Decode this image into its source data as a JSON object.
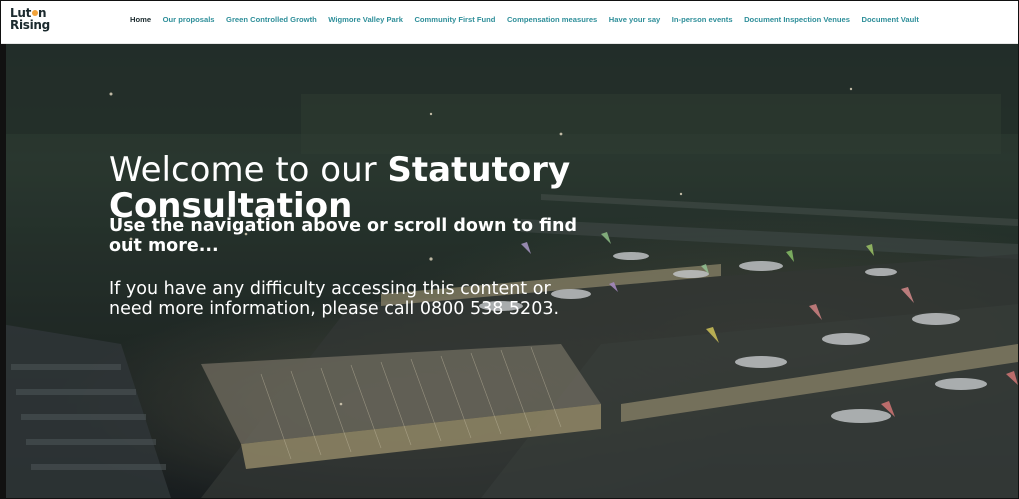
{
  "brand": {
    "line1": "Lut",
    "line1_after_dot": "n",
    "line2": "Rising"
  },
  "nav": {
    "items": [
      "Home",
      "Our proposals",
      "Green Controlled Growth",
      "Wigmore Valley Park",
      "Community First Fund",
      "Compensation measures",
      "Have your say",
      "In-person events",
      "Document Inspection Venues",
      "Document Vault"
    ],
    "active_index": 0
  },
  "hero": {
    "heading_prefix": "Welcome to our ",
    "heading_bold": "Statutory Consultation",
    "subheading": "Use the navigation above or scroll down to find out more...",
    "info": "If you have any difficulty accessing this content or need more information, please call 0800 538 5203."
  },
  "colors": {
    "nav_link": "#2f8f9a",
    "nav_active": "#1b2a2e",
    "logo_dot": "#f2a33a"
  },
  "icons": {
    "hero_image": "airport-aerial-night-image"
  }
}
